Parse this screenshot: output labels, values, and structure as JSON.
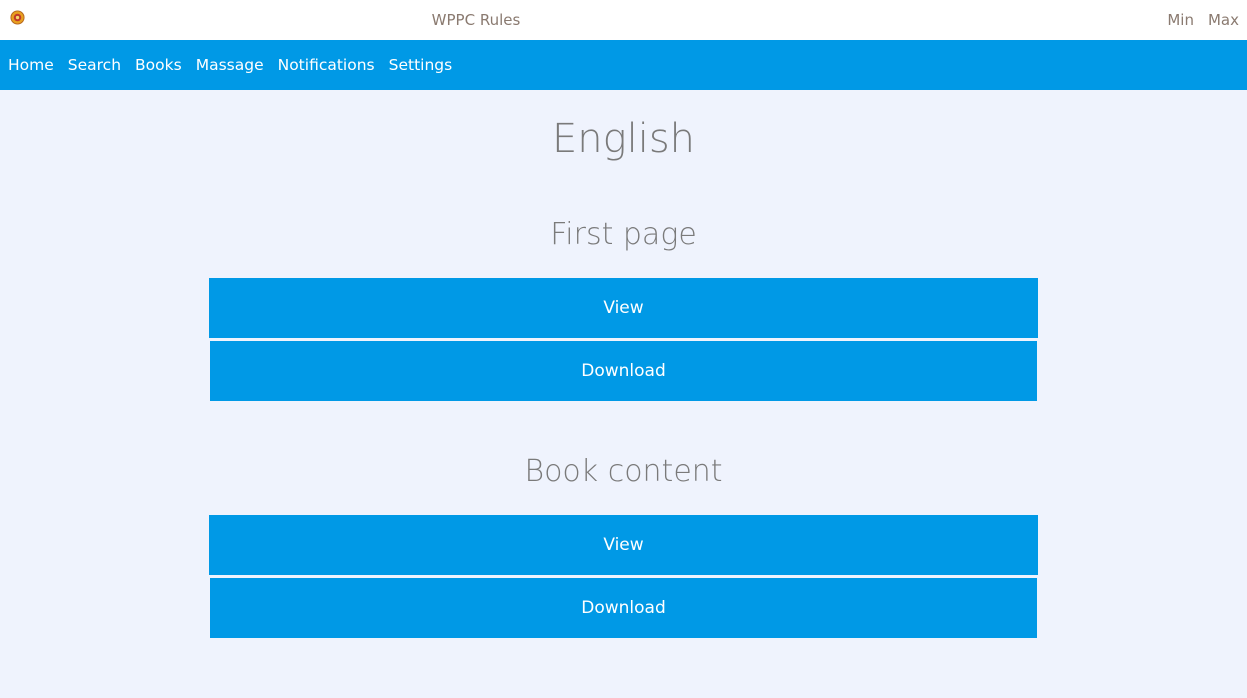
{
  "window": {
    "title": "WPPC Rules",
    "min_label": "Min",
    "max_label": "Max"
  },
  "nav": {
    "items": [
      {
        "label": "Home"
      },
      {
        "label": "Search"
      },
      {
        "label": "Books"
      },
      {
        "label": "Massage"
      },
      {
        "label": "Notifications"
      },
      {
        "label": "Settings"
      }
    ]
  },
  "main": {
    "heading": "English",
    "sections": [
      {
        "title": "First page",
        "view_label": "View",
        "download_label": "Download"
      },
      {
        "title": "Book content",
        "view_label": "View",
        "download_label": "Download"
      }
    ]
  },
  "colors": {
    "accent": "#0099e6",
    "background": "#eff3fd",
    "heading_text": "#7a7a7a"
  },
  "icons": {
    "app": "emblem-icon"
  }
}
